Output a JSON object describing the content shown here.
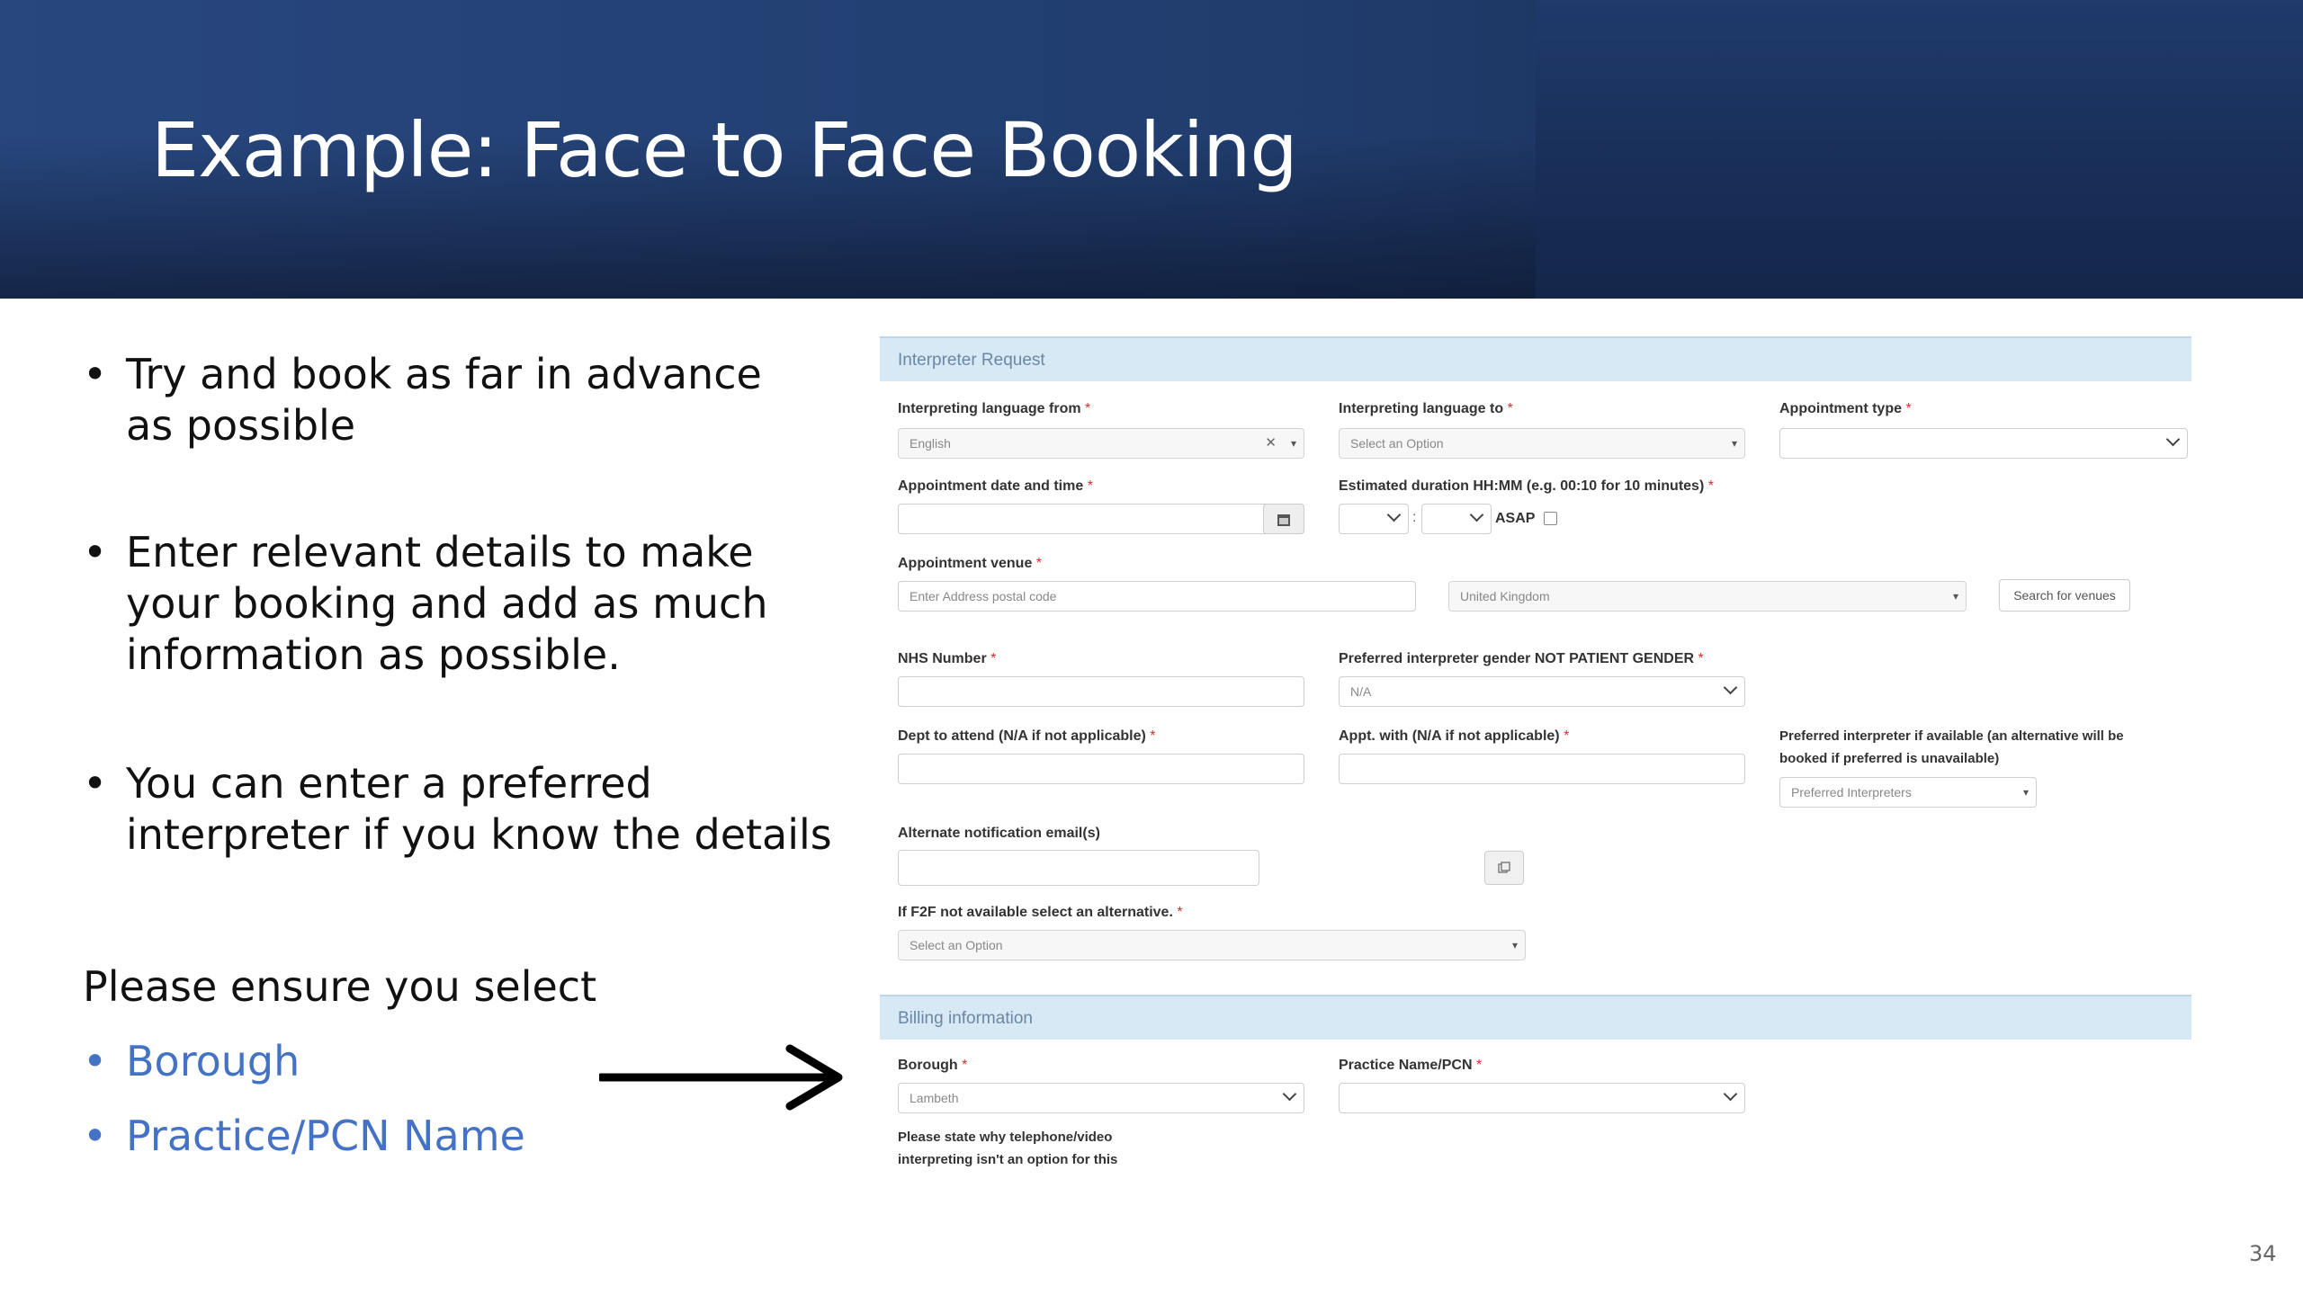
{
  "slide": {
    "title": "Example: Face to Face Booking",
    "bullets": [
      "Try and book as far in advance as possible",
      "Enter relevant details to make your booking and add as much information as possible.",
      "You can enter a preferred interpreter if you know the details"
    ],
    "bullet_glyph": "•",
    "ensure_text": "Please ensure you select",
    "ensure_items": [
      "Borough",
      "Practice/PCN Name"
    ],
    "page_number": "34",
    "colors": {
      "header": "#213d6e",
      "highlight": "#4472c4"
    }
  },
  "form": {
    "section_request": "Interpreter Request",
    "required_mark": "*",
    "lang_from": {
      "label": "Interpreting language from",
      "value": "English"
    },
    "lang_to": {
      "label": "Interpreting language to",
      "placeholder": "Select an Option"
    },
    "appt_type": {
      "label": "Appointment type",
      "value": ""
    },
    "appt_datetime": {
      "label": "Appointment date and time",
      "value": ""
    },
    "duration": {
      "label": "Estimated duration HH:MM (e.g. 00:10 for 10 minutes)",
      "separator": ":",
      "asap_label": "ASAP"
    },
    "venue": {
      "label": "Appointment venue",
      "placeholder": "Enter Address postal code",
      "country": "United Kingdom",
      "search_button": "Search for venues"
    },
    "nhs": {
      "label": "NHS Number",
      "value": ""
    },
    "gender": {
      "label": "Preferred interpreter gender NOT PATIENT GENDER",
      "value": "N/A"
    },
    "dept": {
      "label": "Dept to attend (N/A if not applicable)",
      "value": ""
    },
    "appt_with": {
      "label": "Appt. with (N/A if not applicable)",
      "value": ""
    },
    "pref_interp": {
      "label_line1": "Preferred interpreter if available (an alternative will be",
      "label_line2": "booked if preferred is unavailable)",
      "placeholder": "Preferred Interpreters"
    },
    "alt_email": {
      "label": "Alternate notification email(s)",
      "value": ""
    },
    "f2f_alt": {
      "label": "If F2F not available select an alternative.",
      "placeholder": "Select an Option"
    },
    "section_billing": "Billing information",
    "borough": {
      "label": "Borough",
      "value": "Lambeth"
    },
    "practice": {
      "label": "Practice Name/PCN",
      "value": ""
    },
    "telephone_note": {
      "line1": "Please state why telephone/video",
      "line2": "interpreting isn't an option for this"
    }
  },
  "icons": [
    "calendar-icon",
    "copy-icon",
    "arrow-right-icon",
    "chevron-down-icon",
    "clear-icon",
    "checkbox-icon"
  ]
}
